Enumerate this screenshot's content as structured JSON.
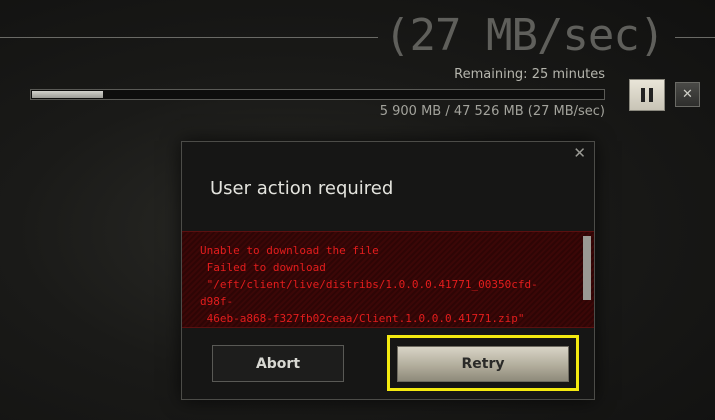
{
  "header": {
    "big_speed": "(27 MB/sec)",
    "remaining": "Remaining: 25 minutes",
    "progress_text": "5 900 MB / 47 526 MB (27 MB/sec)",
    "progress_fraction": 0.124
  },
  "controls": {
    "pause_icon": "pause-icon",
    "stop_label": "✕"
  },
  "dialog": {
    "title": "User action required",
    "close_label": "✕",
    "error_message": "Unable to download the file\n Failed to download\n \"/eft/client/live/distribs/1.0.0.0.41771_00350cfd-d98f-\n 46eb-a868-f327fb02ceaa/Client.1.0.0.0.41771.zip\"",
    "abort_label": "Abort",
    "retry_label": "Retry"
  },
  "colors": {
    "error_red": "#e41d1d",
    "highlight_yellow": "#f4ea10"
  }
}
